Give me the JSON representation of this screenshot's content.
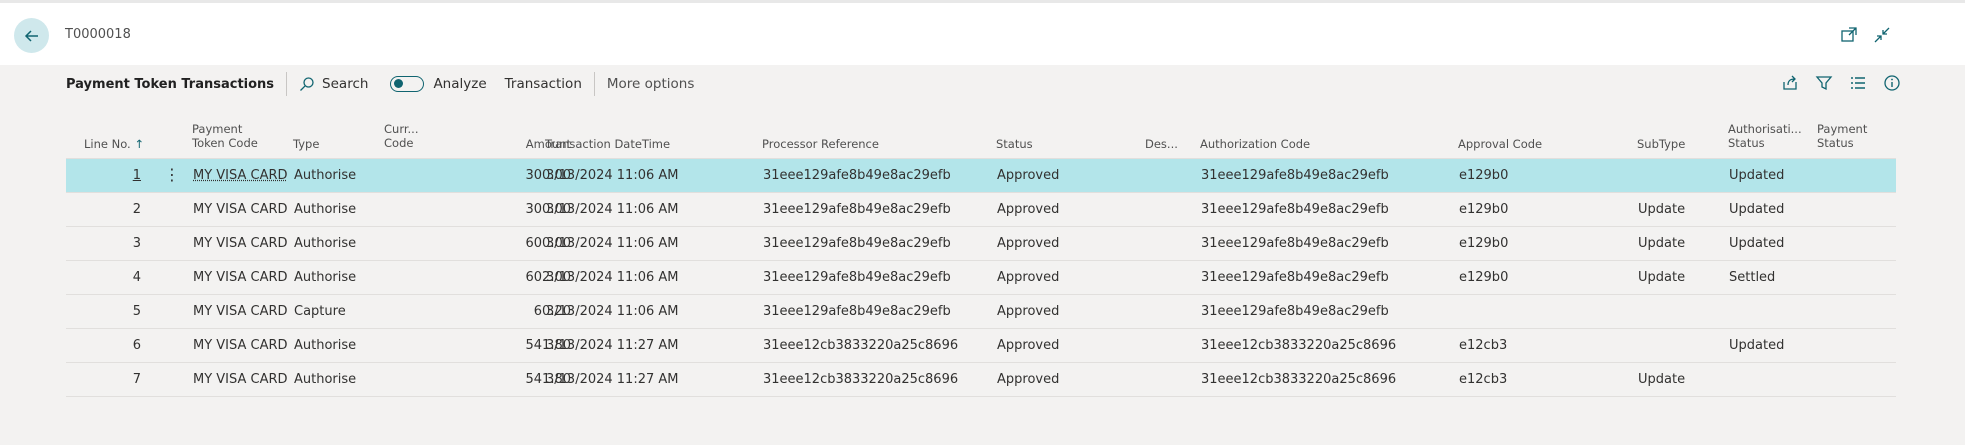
{
  "header": {
    "record_id": "T0000018"
  },
  "actionbar": {
    "page_title": "Payment Token Transactions",
    "search_label": "Search",
    "analyze_label": "Analyze",
    "transaction_label": "Transaction",
    "more_options_label": "More options"
  },
  "columns": {
    "line_no": "Line No.",
    "payment_token_code_1": "Payment",
    "payment_token_code_2": "Token Code",
    "type": "Type",
    "currency_1": "Curr...",
    "currency_2": "Code",
    "amount": "Amount",
    "datetime": "Transaction DateTime",
    "processor_ref": "Processor Reference",
    "status": "Status",
    "description": "Des...",
    "auth_code": "Authorization Code",
    "approval_code": "Approval Code",
    "subtype": "SubType",
    "auth_status_1": "Authorisati...",
    "auth_status_2": "Status",
    "payment_status_1": "Payment",
    "payment_status_2": "Status"
  },
  "rows": [
    {
      "line": "1",
      "token": "MY VISA CARD",
      "type": "Authorise",
      "amount": "300.00",
      "datetime": "3/13/2024 11:06 AM",
      "processor_ref": "31eee129afe8b49e8ac29efb",
      "status": "Approved",
      "auth_code": "31eee129afe8b49e8ac29efb",
      "approval": "e129b0",
      "subtype": "",
      "auth_status": "Updated"
    },
    {
      "line": "2",
      "token": "MY VISA CARD",
      "type": "Authorise",
      "amount": "300.00",
      "datetime": "3/13/2024 11:06 AM",
      "processor_ref": "31eee129afe8b49e8ac29efb",
      "status": "Approved",
      "auth_code": "31eee129afe8b49e8ac29efb",
      "approval": "e129b0",
      "subtype": "Update",
      "auth_status": "Updated"
    },
    {
      "line": "3",
      "token": "MY VISA CARD",
      "type": "Authorise",
      "amount": "600.00",
      "datetime": "3/13/2024 11:06 AM",
      "processor_ref": "31eee129afe8b49e8ac29efb",
      "status": "Approved",
      "auth_code": "31eee129afe8b49e8ac29efb",
      "approval": "e129b0",
      "subtype": "Update",
      "auth_status": "Updated"
    },
    {
      "line": "4",
      "token": "MY VISA CARD",
      "type": "Authorise",
      "amount": "602.00",
      "datetime": "3/13/2024 11:06 AM",
      "processor_ref": "31eee129afe8b49e8ac29efb",
      "status": "Approved",
      "auth_code": "31eee129afe8b49e8ac29efb",
      "approval": "e129b0",
      "subtype": "Update",
      "auth_status": "Settled"
    },
    {
      "line": "5",
      "token": "MY VISA CARD",
      "type": "Capture",
      "amount": "60.20",
      "datetime": "3/13/2024 11:06 AM",
      "processor_ref": "31eee129afe8b49e8ac29efb",
      "status": "Approved",
      "auth_code": "31eee129afe8b49e8ac29efb",
      "approval": "",
      "subtype": "",
      "auth_status": ""
    },
    {
      "line": "6",
      "token": "MY VISA CARD",
      "type": "Authorise",
      "amount": "541.80",
      "datetime": "3/13/2024 11:27 AM",
      "processor_ref": "31eee12cb3833220a25c8696",
      "status": "Approved",
      "auth_code": "31eee12cb3833220a25c8696",
      "approval": "e12cb3",
      "subtype": "",
      "auth_status": "Updated"
    },
    {
      "line": "7",
      "token": "MY VISA CARD",
      "type": "Authorise",
      "amount": "541.80",
      "datetime": "3/13/2024 11:27 AM",
      "processor_ref": "31eee12cb3833220a25c8696",
      "status": "Approved",
      "auth_code": "31eee12cb3833220a25c8696",
      "approval": "e12cb3",
      "subtype": "Update",
      "auth_status": ""
    }
  ],
  "sort_indicator": "↑",
  "row_menu_glyph": "⋮",
  "colors": {
    "accent": "#106470",
    "selected_row": "#b3e5ea",
    "background": "#f3f2f1"
  }
}
